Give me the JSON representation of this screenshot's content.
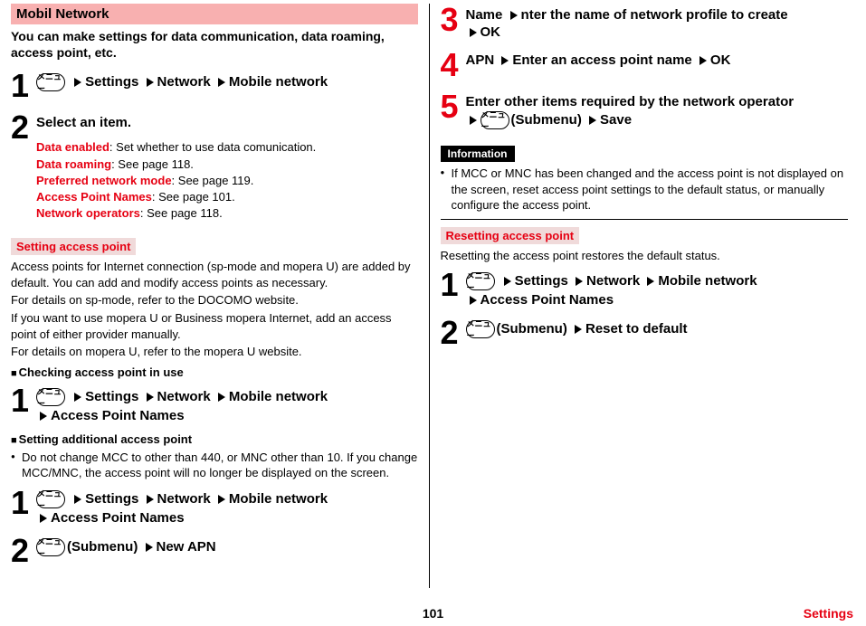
{
  "menu_label": "メニュー",
  "left": {
    "headerTitle": "Mobil Network",
    "intro": "You can make settings for data communication, data roaming, access point, etc.",
    "step1": {
      "num": "1",
      "nav1": "Settings",
      "nav2": "Network",
      "nav3": "Mobile network"
    },
    "step2": {
      "num": "2",
      "title": "Select an item.",
      "items": [
        {
          "term": "Data enabled",
          "desc": ": Set whether to use data comunication."
        },
        {
          "term": "Data roaming",
          "desc": ": See page 118."
        },
        {
          "term": "Preferred network mode",
          "desc": ": See page 119."
        },
        {
          "term": "Access Point Names",
          "desc": ": See page 101."
        },
        {
          "term": "Network operators",
          "desc": ": See page 118."
        }
      ]
    },
    "subsec1": "Setting access point",
    "subsec1_body": [
      "Access points for Internet connection (sp-mode and mopera U) are added by default. You can add and modify access points as necessary.",
      "For details on sp-mode, refer to the DOCOMO website.",
      "If you want to use mopera U or Business mopera Internet, add an access point of either provider manually.",
      "For details on mopera U, refer to the mopera U website."
    ],
    "check_title": "Checking access point in use",
    "check_step": {
      "num": "1",
      "nav1": "Settings",
      "nav2": "Network",
      "nav3": "Mobile network",
      "nav4": "Access Point Names"
    },
    "add_title": "Setting additional access point",
    "add_bullet": "Do not change MCC to other than 440, or MNC other than 10. If you change MCC/MNC, the access point will no longer be displayed on the screen.",
    "add_step1": {
      "num": "1",
      "nav1": "Settings",
      "nav2": "Network",
      "nav3": "Mobile network",
      "nav4": "Access Point Names"
    },
    "add_step2": {
      "num": "2",
      "submenu": "(Submenu)",
      "nav1": "New APN"
    }
  },
  "right": {
    "step3": {
      "num": "3",
      "t1": "Name",
      "t2": "nter the name of network profile to create",
      "t3": "OK"
    },
    "step4": {
      "num": "4",
      "t1": "APN",
      "t2": "Enter an access point name",
      "t3": "OK"
    },
    "step5": {
      "num": "5",
      "t1": "Enter other items required by the network operator",
      "submenu": "(Submenu)",
      "t2": "Save"
    },
    "info_header": "Information",
    "info_body": "If MCC or MNC has been changed and the access point is not displayed on the screen, reset access point settings to the default status, or manually configure the access point.",
    "subsec2": "Resetting access point",
    "subsec2_body": "Resetting the access point restores the default status.",
    "reset_step1": {
      "num": "1",
      "nav1": "Settings",
      "nav2": "Network",
      "nav3": "Mobile network",
      "nav4": "Access Point Names"
    },
    "reset_step2": {
      "num": "2",
      "submenu": "(Submenu)",
      "nav1": "Reset to default"
    }
  },
  "footer": {
    "page": "101",
    "section": "Settings"
  }
}
